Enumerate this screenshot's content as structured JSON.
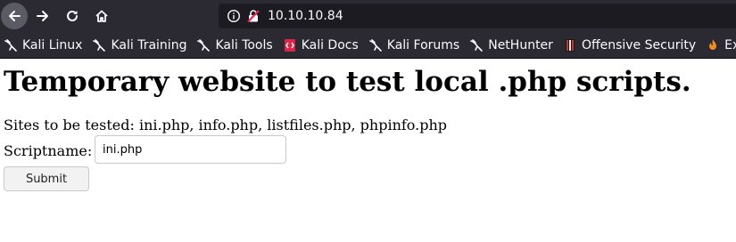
{
  "browser": {
    "url": "10.10.10.84",
    "nav_icons": [
      "back-arrow-icon",
      "forward-arrow-icon",
      "reload-icon",
      "home-icon"
    ],
    "url_icons": [
      "info-icon",
      "insecure-lock-icon"
    ],
    "bookmarks": [
      {
        "label": "Kali Linux",
        "icon": "kali-dragon-icon"
      },
      {
        "label": "Kali Training",
        "icon": "kali-dragon-icon"
      },
      {
        "label": "Kali Tools",
        "icon": "kali-dragon-icon"
      },
      {
        "label": "Kali Docs",
        "icon": "kali-docs-icon"
      },
      {
        "label": "Kali Forums",
        "icon": "kali-dragon-icon"
      },
      {
        "label": "NetHunter",
        "icon": "kali-dragon-icon"
      },
      {
        "label": "Offensive Security",
        "icon": "offsec-icon"
      },
      {
        "label": "Exploit",
        "icon": "exploit-db-icon"
      }
    ]
  },
  "page": {
    "title": "Temporary website to test local .php scripts.",
    "sites_text": "Sites to be tested: ini.php, info.php, listfiles.php, phpinfo.php",
    "script_label": "Scriptname:",
    "script_value": "ini.php",
    "submit_label": "Submit"
  },
  "colors": {
    "chrome_bg": "#2b2a33",
    "url_bg": "#1c1b22",
    "chrome_text": "#fbfbfe",
    "insecure_red": "#e22850",
    "docs_red": "#d7264a"
  }
}
